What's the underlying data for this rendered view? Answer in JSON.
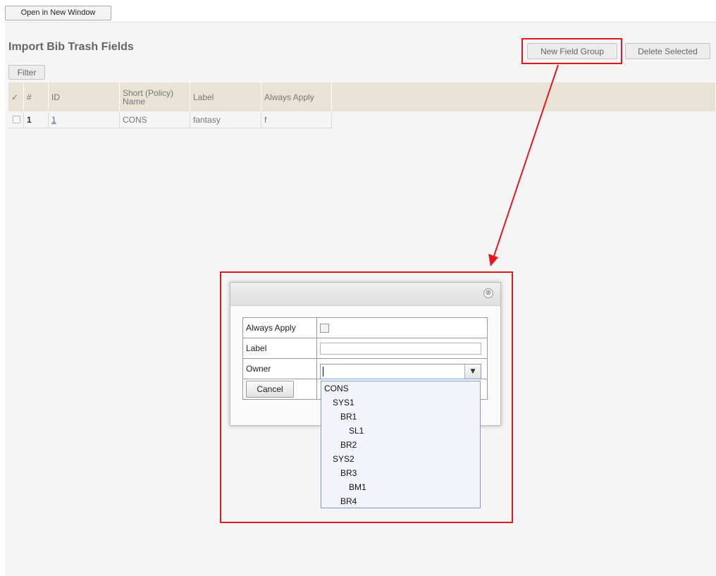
{
  "toolbar": {
    "open_new_window": "Open in New Window"
  },
  "page": {
    "title": "Import Bib Trash Fields",
    "filter_label": "Filter",
    "new_field_group_label": "New Field Group",
    "delete_selected_label": "Delete Selected"
  },
  "grid": {
    "columns": [
      "✓",
      "#",
      "ID",
      "Short (Policy) Name",
      "Label",
      "Always Apply"
    ],
    "rows": [
      {
        "num": "1",
        "id": "1",
        "short_name": "CONS",
        "label": "fantasy",
        "always_apply": "f"
      }
    ]
  },
  "dialog": {
    "close_glyph": "⊗",
    "fields": {
      "always_apply_label": "Always Apply",
      "label_label": "Label",
      "owner_label": "Owner"
    },
    "cancel_label": "Cancel",
    "owner_value": "",
    "owner_dropdown_glyph": "▼",
    "owner_options": [
      {
        "text": "CONS",
        "depth": 0
      },
      {
        "text": "SYS1",
        "depth": 1
      },
      {
        "text": "BR1",
        "depth": 2
      },
      {
        "text": "SL1",
        "depth": 3
      },
      {
        "text": "BR2",
        "depth": 2
      },
      {
        "text": "SYS2",
        "depth": 1
      },
      {
        "text": "BR3",
        "depth": 2
      },
      {
        "text": "BM1",
        "depth": 3
      },
      {
        "text": "BR4",
        "depth": 2
      }
    ]
  },
  "annotation": {
    "color": "#e0191e"
  }
}
